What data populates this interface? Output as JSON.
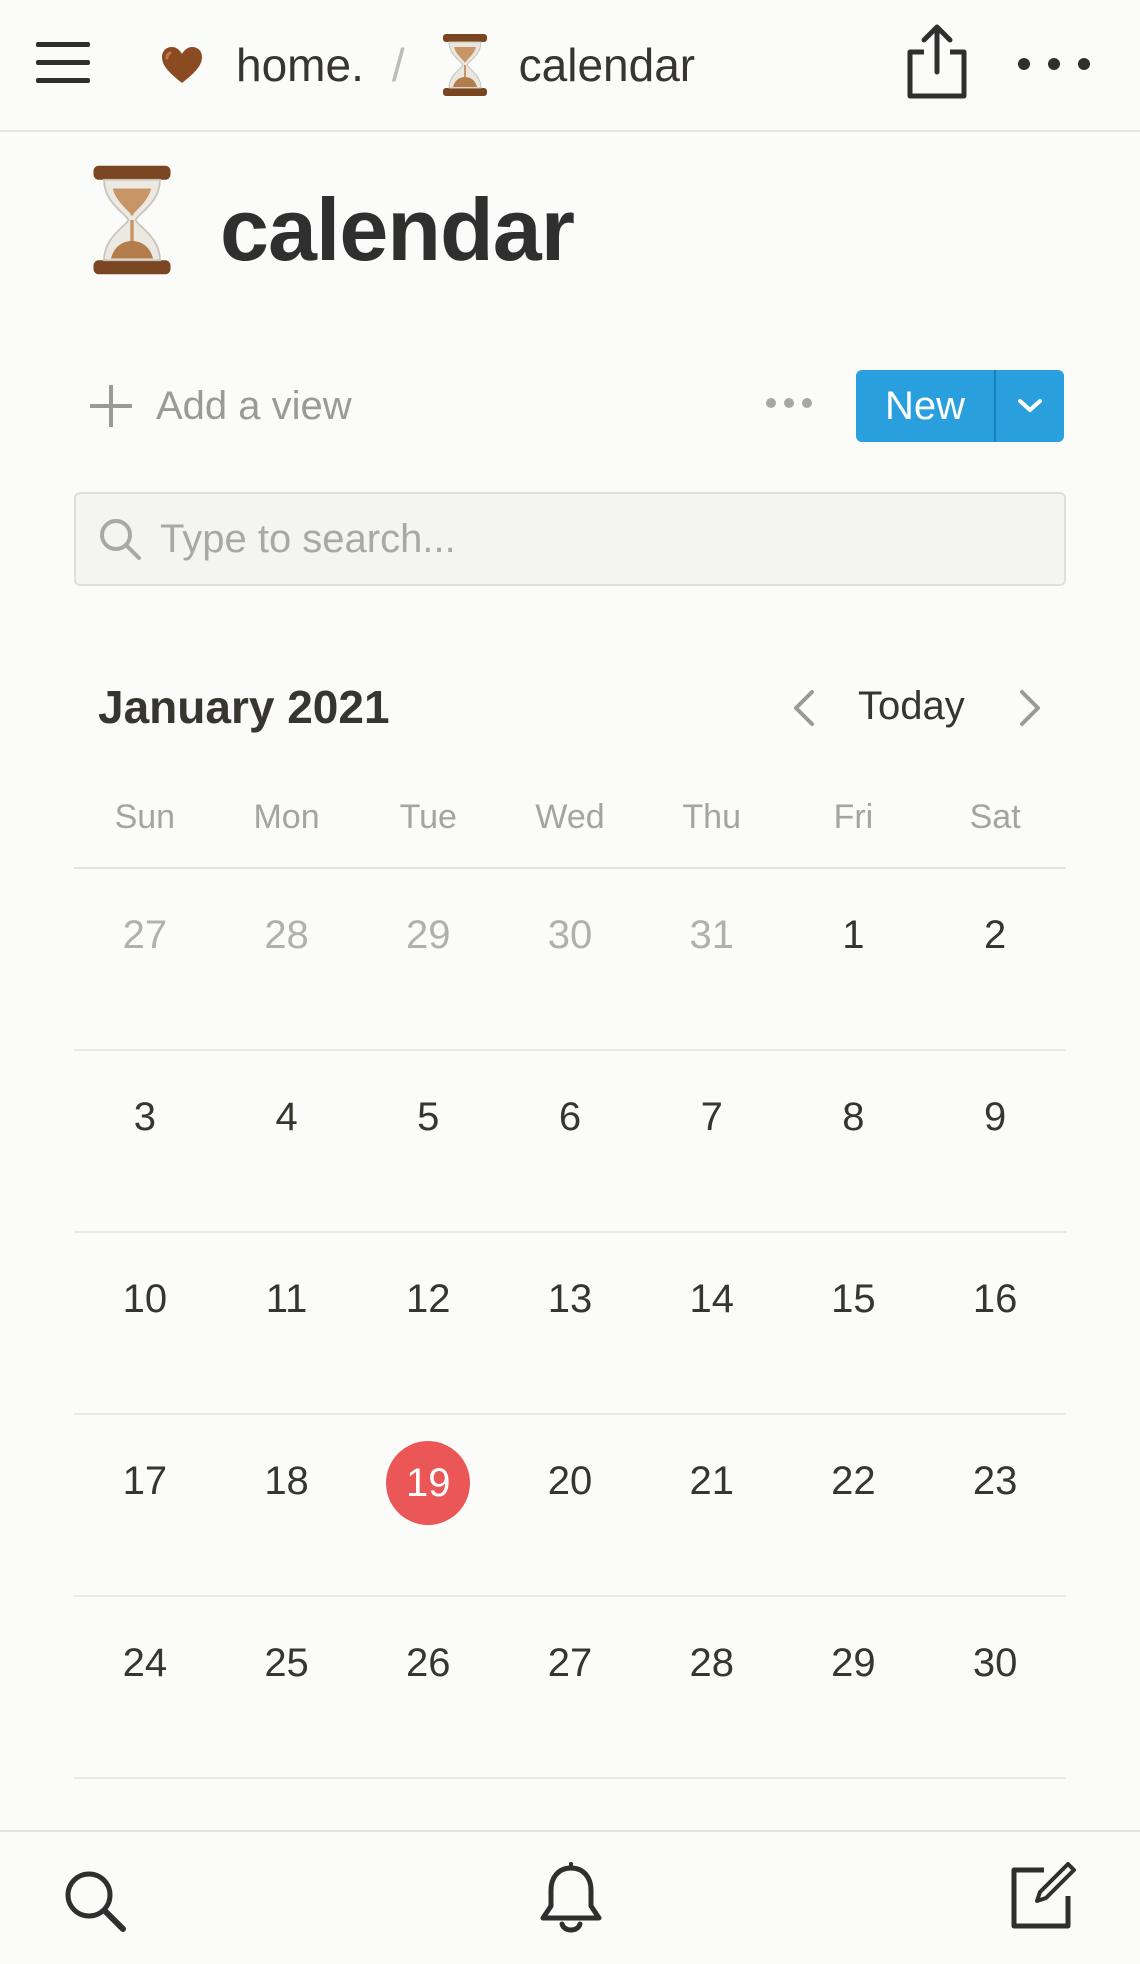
{
  "header": {
    "breadcrumb_home": "home.",
    "breadcrumb_sep": "/",
    "breadcrumb_current": "calendar",
    "icons": [
      "menu-icon",
      "heart-icon",
      "hourglass-icon",
      "share-icon",
      "more-icon"
    ]
  },
  "page": {
    "title": "calendar",
    "icon": "hourglass-icon"
  },
  "toolbar": {
    "add_view_label": "Add a view",
    "new_label": "New"
  },
  "search": {
    "placeholder": "Type to search..."
  },
  "calendar": {
    "month_label": "January 2021",
    "today_label": "Today",
    "weekdays": [
      "Sun",
      "Mon",
      "Tue",
      "Wed",
      "Thu",
      "Fri",
      "Sat"
    ],
    "today": "19",
    "weeks": [
      [
        {
          "d": "27",
          "muted": true
        },
        {
          "d": "28",
          "muted": true
        },
        {
          "d": "29",
          "muted": true
        },
        {
          "d": "30",
          "muted": true
        },
        {
          "d": "31",
          "muted": true
        },
        {
          "d": "1"
        },
        {
          "d": "2"
        }
      ],
      [
        {
          "d": "3"
        },
        {
          "d": "4"
        },
        {
          "d": "5"
        },
        {
          "d": "6"
        },
        {
          "d": "7"
        },
        {
          "d": "8"
        },
        {
          "d": "9"
        }
      ],
      [
        {
          "d": "10"
        },
        {
          "d": "11"
        },
        {
          "d": "12"
        },
        {
          "d": "13"
        },
        {
          "d": "14"
        },
        {
          "d": "15"
        },
        {
          "d": "16"
        }
      ],
      [
        {
          "d": "17"
        },
        {
          "d": "18"
        },
        {
          "d": "19",
          "today": true
        },
        {
          "d": "20"
        },
        {
          "d": "21"
        },
        {
          "d": "22"
        },
        {
          "d": "23"
        }
      ],
      [
        {
          "d": "24"
        },
        {
          "d": "25"
        },
        {
          "d": "26"
        },
        {
          "d": "27"
        },
        {
          "d": "28"
        },
        {
          "d": "29"
        },
        {
          "d": "30"
        }
      ]
    ]
  },
  "bottom_bar": {
    "icons": [
      "search-icon",
      "bell-icon",
      "compose-icon"
    ]
  },
  "colors": {
    "accent": "#2a9fdd",
    "today": "#eb5757",
    "text": "#37352f",
    "muted": "#b1b0ac",
    "background": "#fbfbfa"
  }
}
